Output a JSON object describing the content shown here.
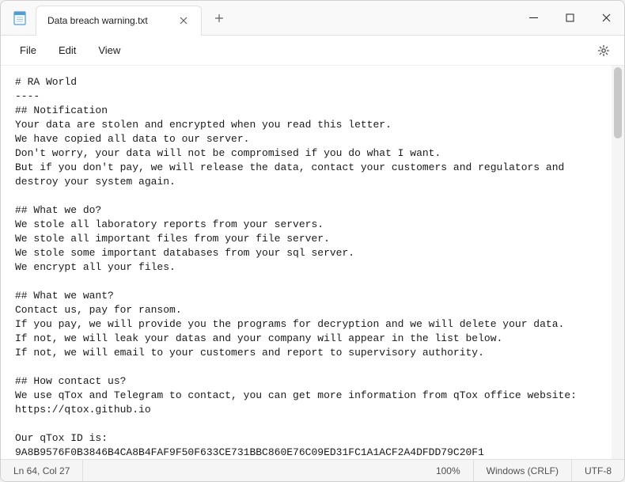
{
  "window": {
    "tab_title": "Data breach warning.txt"
  },
  "menu": {
    "file": "File",
    "edit": "Edit",
    "view": "View"
  },
  "document": {
    "text": "# RA World\n----\n## Notification\nYour data are stolen and encrypted when you read this letter.\nWe have copied all data to our server.\nDon't worry, your data will not be compromised if you do what I want.\nBut if you don't pay, we will release the data, contact your customers and regulators and destroy your system again.\n\n## What we do?\nWe stole all laboratory reports from your servers.\nWe stole all important files from your file server.\nWe stole some important databases from your sql server.\nWe encrypt all your files.\n\n## What we want?\nContact us, pay for ransom.\nIf you pay, we will provide you the programs for decryption and we will delete your data.\nIf not, we will leak your datas and your company will appear in the list below.\nIf not, we will email to your customers and report to supervisory authority.\n\n## How contact us?\nWe use qTox and Telegram to contact, you can get more information from qTox office website: https://qtox.github.io\n\nOur qTox ID is:\n9A8B9576F0B3846B4CA8B4FAF9F50F633CE731BBC860E76C09ED31FC1A1ACF2A4DFDD79C20F1"
  },
  "statusbar": {
    "position": "Ln 64, Col 27",
    "zoom": "100%",
    "line_ending": "Windows (CRLF)",
    "encoding": "UTF-8"
  }
}
